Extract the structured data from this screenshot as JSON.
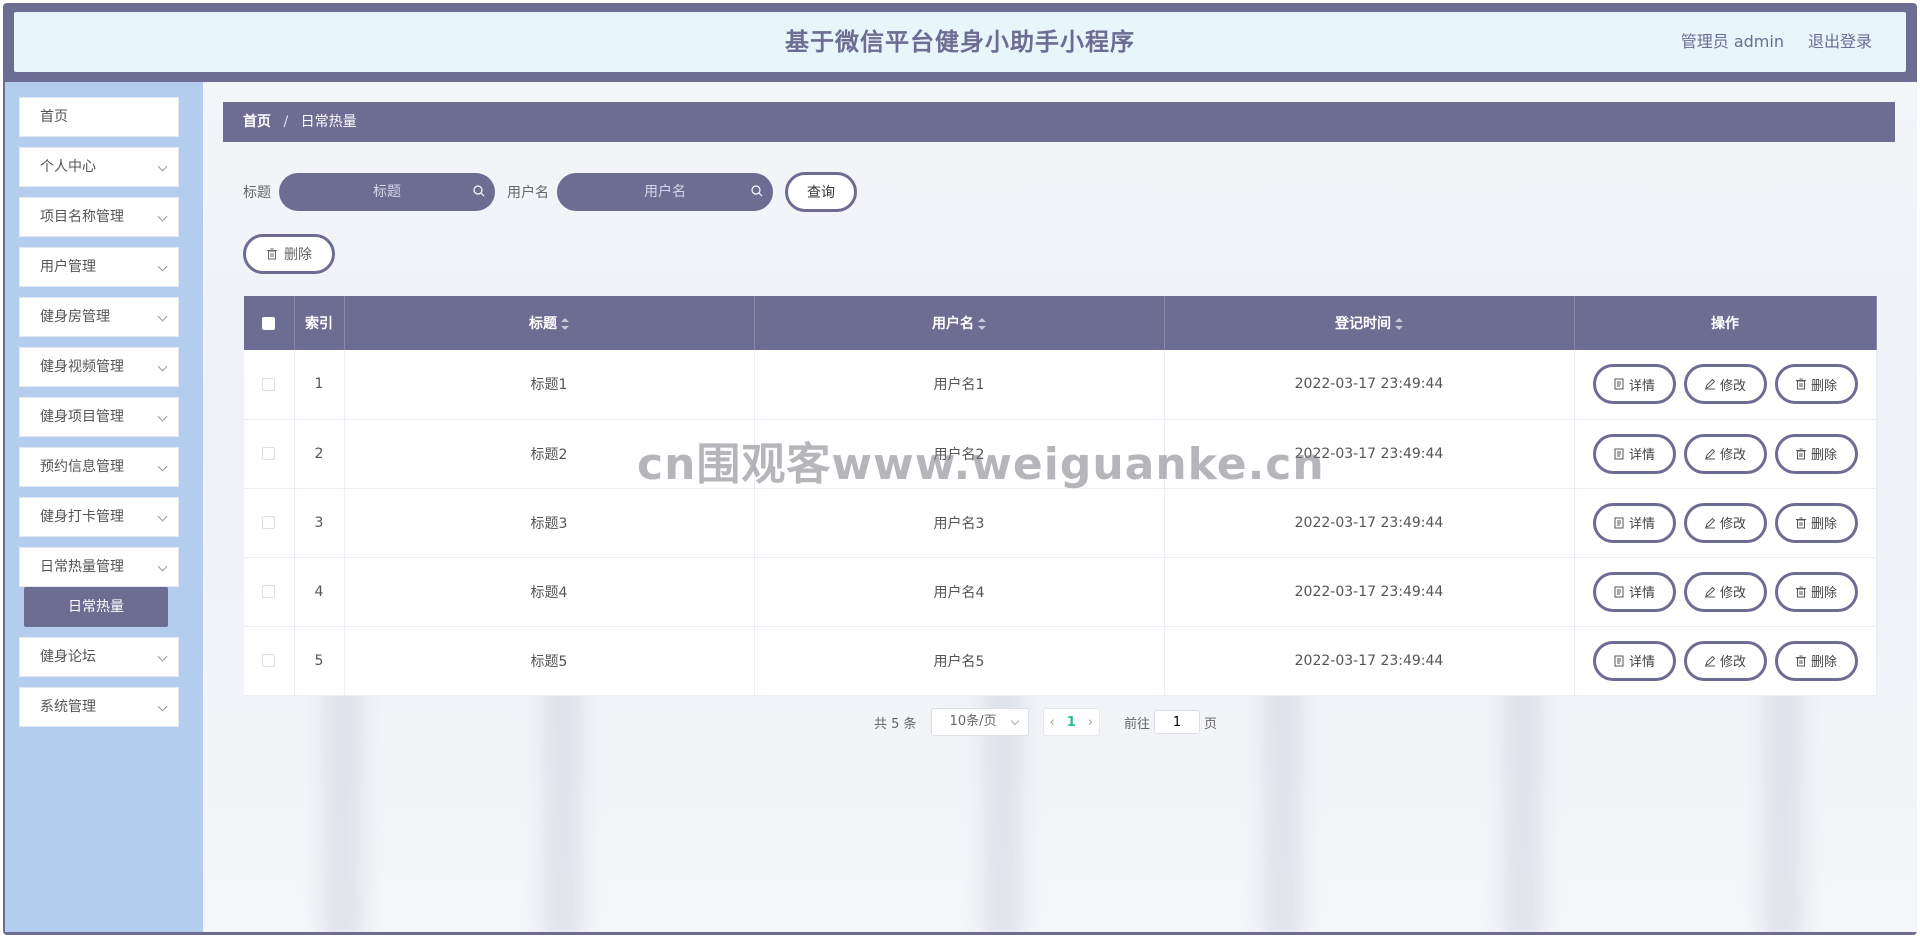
{
  "header": {
    "title": "基于微信平台健身小助手小程序",
    "user_label": "管理员 admin",
    "logout_label": "退出登录"
  },
  "sidebar": {
    "items": [
      {
        "label": "首页",
        "has_children": false
      },
      {
        "label": "个人中心",
        "has_children": true
      },
      {
        "label": "项目名称管理",
        "has_children": true
      },
      {
        "label": "用户管理",
        "has_children": true
      },
      {
        "label": "健身房管理",
        "has_children": true
      },
      {
        "label": "健身视频管理",
        "has_children": true
      },
      {
        "label": "健身项目管理",
        "has_children": true
      },
      {
        "label": "预约信息管理",
        "has_children": true
      },
      {
        "label": "健身打卡管理",
        "has_children": true
      },
      {
        "label": "日常热量管理",
        "has_children": true
      },
      {
        "label": "健身论坛",
        "has_children": true
      },
      {
        "label": "系统管理",
        "has_children": true
      }
    ],
    "active_sub": "日常热量"
  },
  "breadcrumb": {
    "home": "首页",
    "separator": "/",
    "current": "日常热量"
  },
  "search": {
    "title_label": "标题",
    "title_placeholder": "标题",
    "username_label": "用户名",
    "username_placeholder": "用户名",
    "query_button": "查询"
  },
  "toolbar": {
    "delete_label": "删除"
  },
  "table": {
    "headers": {
      "index": "索引",
      "title": "标题",
      "username": "用户名",
      "time": "登记时间",
      "actions": "操作"
    },
    "rows": [
      {
        "index": "1",
        "title": "标题1",
        "username": "用户名1",
        "time": "2022-03-17 23:49:44"
      },
      {
        "index": "2",
        "title": "标题2",
        "username": "用户名2",
        "time": "2022-03-17 23:49:44"
      },
      {
        "index": "3",
        "title": "标题3",
        "username": "用户名3",
        "time": "2022-03-17 23:49:44"
      },
      {
        "index": "4",
        "title": "标题4",
        "username": "用户名4",
        "time": "2022-03-17 23:49:44"
      },
      {
        "index": "5",
        "title": "标题5",
        "username": "用户名5",
        "time": "2022-03-17 23:49:44"
      }
    ],
    "action_labels": {
      "detail": "详情",
      "edit": "修改",
      "delete": "删除"
    }
  },
  "pagination": {
    "total_text": "共 5 条",
    "page_size": "10条/页",
    "current_page": "1",
    "goto_prefix": "前往",
    "goto_value": "1",
    "goto_suffix": "页"
  },
  "watermark": "cn围观客www.weiguanke.cn",
  "colors": {
    "primary": "#6d6c92",
    "sidebar_bg": "#b4cdef",
    "header_bg": "#e6f6fb",
    "page_active": "#2dbd8b"
  }
}
